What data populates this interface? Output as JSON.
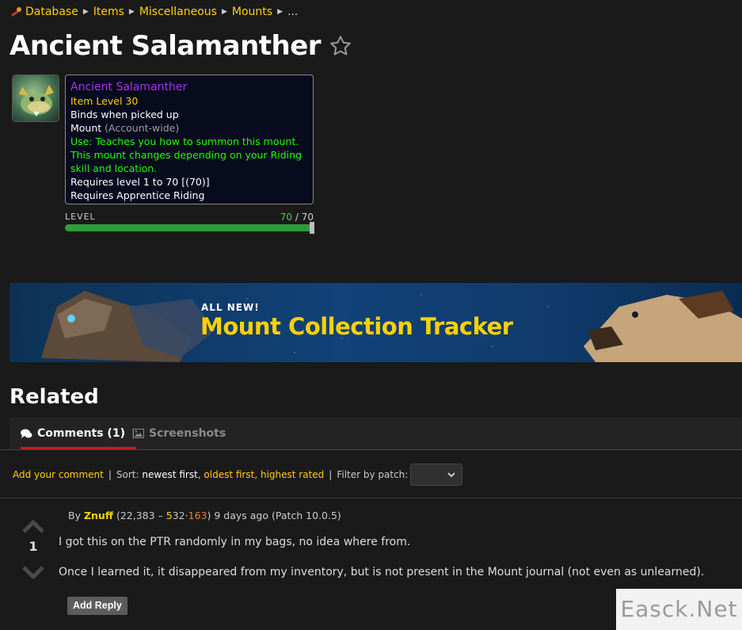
{
  "breadcrumb": {
    "items": [
      "Database",
      "Items",
      "Miscellaneous",
      "Mounts"
    ],
    "ellipsis": "..."
  },
  "title": "Ancient Salamanther",
  "tooltip": {
    "name": "Ancient Salamanther",
    "item_level": "Item Level 30",
    "binds": "Binds when picked up",
    "mount_label": "Mount",
    "mount_note": "(Account-wide)",
    "use_line1": "Use: Teaches you how to summon this mount.",
    "use_line2": "This mount changes depending on your Riding",
    "use_line3": "skill and location.",
    "req_level": "Requires level 1 to 70 [(70)]",
    "req_riding": "Requires Apprentice Riding"
  },
  "level": {
    "label": "LEVEL",
    "current": "70",
    "max": "70",
    "fraction": 1.0,
    "fill_color": "#2c9e36"
  },
  "banner": {
    "kicker": "ALL NEW!",
    "headline": "Mount Collection Tracker"
  },
  "related": {
    "title": "Related",
    "tabs": [
      {
        "label": "Comments (1)",
        "icon": "comments-icon",
        "active": true
      },
      {
        "label": "Screenshots",
        "icon": "image-icon",
        "active": false
      }
    ]
  },
  "toolbar": {
    "add_comment": "Add your comment",
    "sort_label": "Sort:",
    "sort_newest": "newest first",
    "sort_oldest": "oldest first",
    "sort_highest": "highest rated",
    "filter_label": "Filter by patch:",
    "patch_value": ""
  },
  "comment": {
    "score": "1",
    "by": "By",
    "author": "Znuff",
    "reputation": "(22,383 –",
    "badge_gold": "5",
    "badge_silver": "32",
    "badge_bronze": "163",
    "rep_close": ")",
    "time": "9 days ago (Patch 10.0.5)",
    "paragraphs": [
      "I got this on the PTR randomly in my bags, no idea where from.",
      "Once I learned it, it disappeared from my inventory, but is not present in the Mount journal (not even as unlearned)."
    ],
    "reply_label": "Add Reply"
  },
  "watermark": "Easck.Net",
  "colors": {
    "link": "#ffd100",
    "epic": "#a335ee",
    "uncommon": "#1eff00",
    "tab_underline": "#c41e1e"
  }
}
